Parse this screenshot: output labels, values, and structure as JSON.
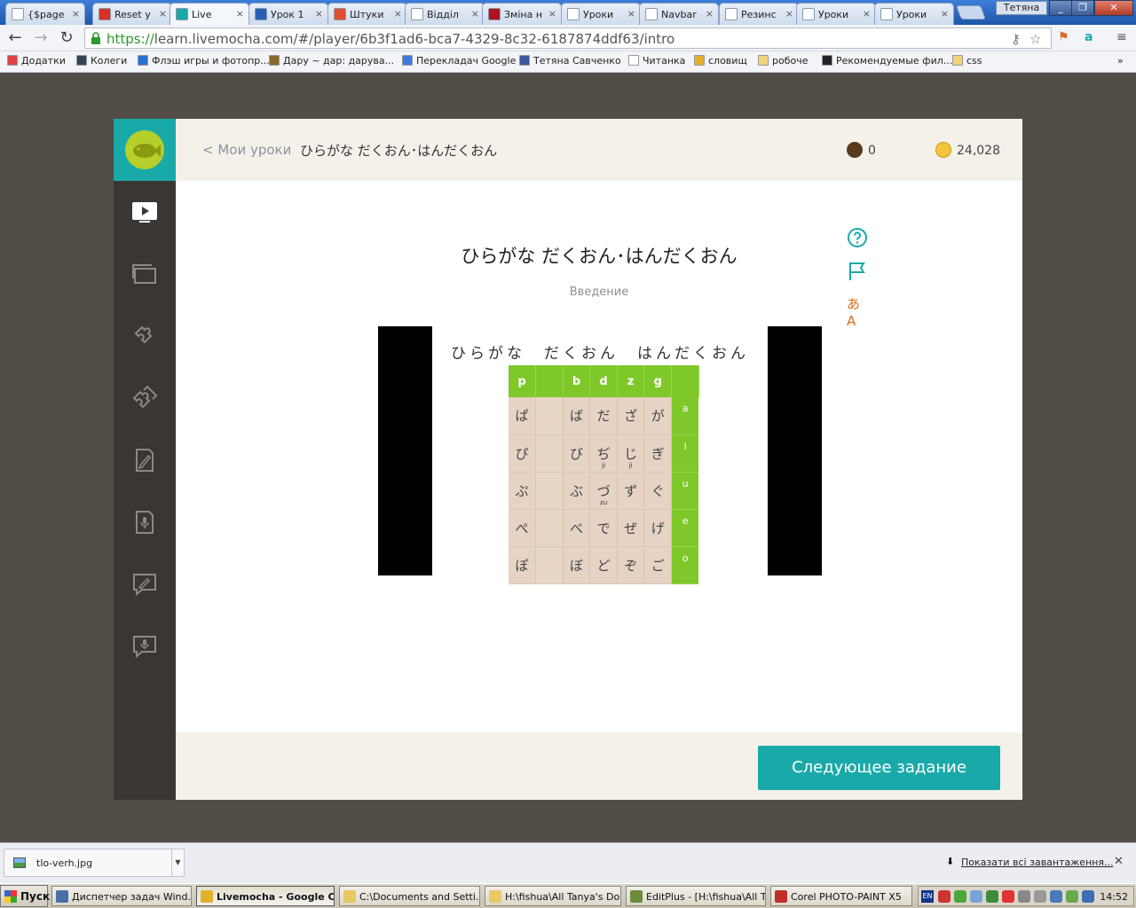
{
  "browser": {
    "tabs": [
      {
        "label": "{$page",
        "icon": "doc-icon",
        "color": "#ffffff"
      },
      {
        "label": "Reset y",
        "icon": "gmail-icon",
        "color": "#d93025"
      },
      {
        "label": "Live",
        "icon": "livemocha-icon",
        "color": "#19a9a9"
      },
      {
        "label": "Урок 1",
        "icon": "word-icon",
        "color": "#2b5fb3"
      },
      {
        "label": "Штуки",
        "icon": "shtuki-icon",
        "color": "#e04f30"
      },
      {
        "label": "Відділ",
        "icon": "doc-icon",
        "color": "#ffffff"
      },
      {
        "label": "Зміна н",
        "icon": "znu-icon",
        "color": "#b3121d"
      },
      {
        "label": "Уроки",
        "icon": "doc-icon",
        "color": "#ffffff"
      },
      {
        "label": "Navbar",
        "icon": "doc-icon",
        "color": "#ffffff"
      },
      {
        "label": "Резинс",
        "icon": "doc-icon",
        "color": "#ffffff"
      },
      {
        "label": "Уроки",
        "icon": "doc-icon",
        "color": "#ffffff"
      },
      {
        "label": "Уроки",
        "icon": "doc-icon",
        "color": "#ffffff"
      }
    ],
    "user_label": "Тетяна",
    "url_scheme": "https://",
    "url_rest": "learn.livemocha.com/#/player/6b3f1ad6-bca7-4329-8c32-6187874ddf63/intro",
    "bookmarks": [
      {
        "label": "Додатки",
        "icon": "apps-icon"
      },
      {
        "label": "Колеги",
        "icon": "person-icon"
      },
      {
        "label": "Флэш игры и фотопр...",
        "icon": "v-icon"
      },
      {
        "label": "Дару ~ дар: дарува...",
        "icon": "mustache-icon"
      },
      {
        "label": "Перекладач Google",
        "icon": "translate-icon"
      },
      {
        "label": "Тетяна Савченко",
        "icon": "facebook-icon"
      },
      {
        "label": "Читанка",
        "icon": "doc-icon"
      },
      {
        "label": "словищ",
        "icon": "crown-icon"
      },
      {
        "label": "робоче",
        "icon": "folder-icon"
      },
      {
        "label": "Рекомендуемые фил...",
        "icon": "i-icon"
      },
      {
        "label": "css",
        "icon": "folder-icon"
      }
    ]
  },
  "app": {
    "back_link": "< Мои уроки",
    "lesson_title": "ひらがな だくおん･はんだくおん",
    "coffee_count": "0",
    "coins_count": "24,028",
    "main_title": "ひらがな だくおん･はんだくおん",
    "subtitle": "Введение",
    "lang_toggle_label": "あA",
    "next_button": "Следующее задание",
    "video": {
      "title": "ひらがな　だくおん　はんだくおん",
      "header": [
        "p",
        "",
        "b",
        "d",
        "z",
        "g",
        ""
      ],
      "rows": [
        {
          "cells": [
            "ぱ",
            "",
            "ば",
            "だ",
            "ざ",
            "が"
          ],
          "notes": [
            "",
            "",
            "",
            "",
            "",
            ""
          ],
          "vowel": "a"
        },
        {
          "cells": [
            "ぴ",
            "",
            "び",
            "ぢ",
            "じ",
            "ぎ"
          ],
          "notes": [
            "",
            "",
            "",
            "ji",
            "ji",
            ""
          ],
          "vowel": "i"
        },
        {
          "cells": [
            "ぷ",
            "",
            "ぶ",
            "づ",
            "ず",
            "ぐ"
          ],
          "notes": [
            "",
            "",
            "",
            "zu",
            "",
            ""
          ],
          "vowel": "u"
        },
        {
          "cells": [
            "ぺ",
            "",
            "べ",
            "で",
            "ぜ",
            "げ"
          ],
          "notes": [
            "",
            "",
            "",
            "",
            "",
            ""
          ],
          "vowel": "e"
        },
        {
          "cells": [
            "ぽ",
            "",
            "ぼ",
            "ど",
            "ぞ",
            "ご"
          ],
          "notes": [
            "",
            "",
            "",
            "",
            "",
            ""
          ],
          "vowel": "o"
        }
      ]
    }
  },
  "downloads": {
    "file_name": "tlo-verh.jpg",
    "show_all": "Показати всі завантаження..."
  },
  "taskbar": {
    "start_label": "Пуск",
    "tasks": [
      {
        "label": "Диспетчер задач Wind...",
        "active": false,
        "color": "#4a6fa5"
      },
      {
        "label": "Livemocha - Google C...",
        "active": true,
        "color": "#e2b12c"
      },
      {
        "label": "C:\\Documents and Setti...",
        "active": false,
        "color": "#e8c860"
      },
      {
        "label": "H:\\fishua\\All Tanya's Do...",
        "active": false,
        "color": "#e8c860"
      },
      {
        "label": "EditPlus - [H:\\fishua\\All T...",
        "active": false,
        "color": "#6b8c3a"
      },
      {
        "label": "Corel PHOTO-PAINT X5",
        "active": false,
        "color": "#c0302a"
      }
    ],
    "lang": "EN",
    "clock": "14:52"
  },
  "colors": {
    "brand_teal": "#19a9a9",
    "kana_green": "#7fc82a",
    "sidebar_dark": "#3a3633",
    "header_cream": "#f4f1ea"
  }
}
